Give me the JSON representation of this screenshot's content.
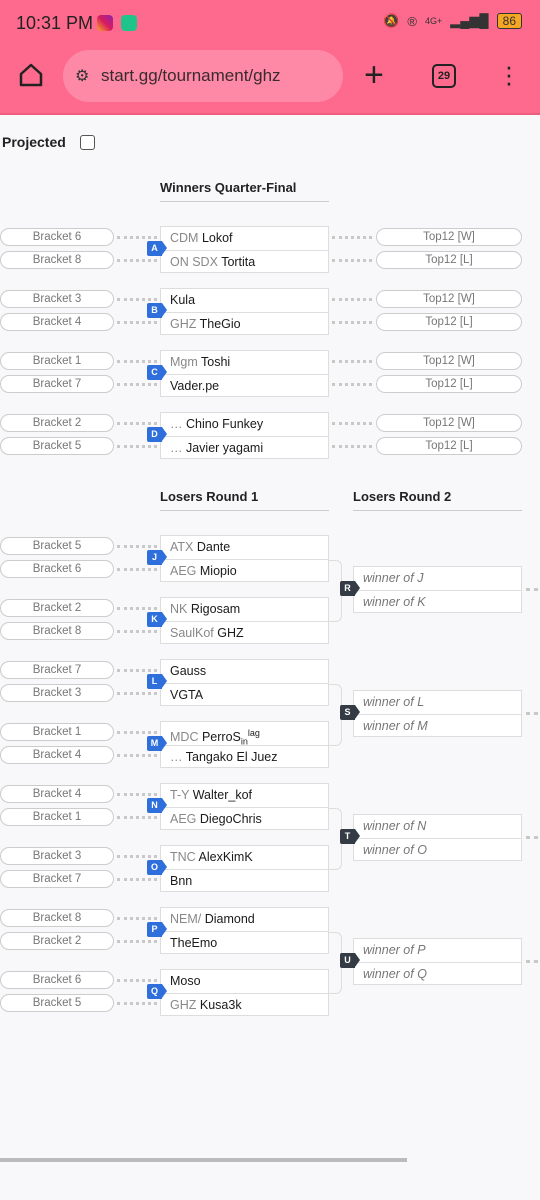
{
  "status_bar": {
    "time": "10:31 PM",
    "network": "4G+",
    "battery": "86",
    "colors": {
      "header": "#fd6a8e"
    }
  },
  "browser": {
    "url": "start.gg/tournament/ghz",
    "tab_count": "29"
  },
  "projected_label": "Projected",
  "projected_checked": false,
  "colors": {
    "winners_badge": "#2f6fdc",
    "losers_r2_badge": "#353b45"
  },
  "winners": {
    "title": "Winners Quarter-Final",
    "matches": [
      {
        "id": "A",
        "left": [
          "Bracket 6",
          "Bracket 8"
        ],
        "right": [
          "Top12 [W]",
          "Top12 [L]"
        ],
        "players": [
          {
            "prefix": "CDM",
            "name": "Lokof"
          },
          {
            "prefix": "ON SDX",
            "name": "Tortita"
          }
        ]
      },
      {
        "id": "B",
        "left": [
          "Bracket 3",
          "Bracket 4"
        ],
        "right": [
          "Top12 [W]",
          "Top12 [L]"
        ],
        "players": [
          {
            "prefix": "",
            "name": "Kula"
          },
          {
            "prefix": "GHZ",
            "name": "TheGio"
          }
        ]
      },
      {
        "id": "C",
        "left": [
          "Bracket 1",
          "Bracket 7"
        ],
        "right": [
          "Top12 [W]",
          "Top12 [L]"
        ],
        "players": [
          {
            "prefix": "Mgm",
            "name": "Toshi"
          },
          {
            "prefix": "",
            "name": "Vader.pe"
          }
        ]
      },
      {
        "id": "D",
        "left": [
          "Bracket 2",
          "Bracket 5"
        ],
        "right": [
          "Top12 [W]",
          "Top12 [L]"
        ],
        "players": [
          {
            "prefix": "…",
            "name": "Chino Funkey"
          },
          {
            "prefix": "…",
            "name": "Javier yagami"
          }
        ]
      }
    ]
  },
  "losers1": {
    "title": "Losers Round 1",
    "matches": [
      {
        "id": "J",
        "left": [
          "Bracket 5",
          "Bracket 6"
        ],
        "players": [
          {
            "prefix": "ATX",
            "name": "Dante"
          },
          {
            "prefix": "AEG",
            "name": "Miopio"
          }
        ]
      },
      {
        "id": "K",
        "left": [
          "Bracket 2",
          "Bracket 8"
        ],
        "players": [
          {
            "prefix": "NK",
            "name": "Rigosam"
          },
          {
            "prefix": "SaulKof",
            "name": "GHZ"
          }
        ]
      },
      {
        "id": "L",
        "left": [
          "Bracket 7",
          "Bracket 3"
        ],
        "players": [
          {
            "prefix": "",
            "name": "Gauss"
          },
          {
            "prefix": "",
            "name": "VGTA"
          }
        ]
      },
      {
        "id": "M",
        "left": [
          "Bracket 1",
          "Bracket 4"
        ],
        "players": [
          {
            "prefix": "MDC",
            "name": "PerroS",
            "sub": "in",
            "sup": "lag"
          },
          {
            "prefix": "…",
            "name": "Tangako El Juez"
          }
        ]
      },
      {
        "id": "N",
        "left": [
          "Bracket 4",
          "Bracket 1"
        ],
        "players": [
          {
            "prefix": "T-Y",
            "name": "Walter_kof"
          },
          {
            "prefix": "AEG",
            "name": "DiegoChris"
          }
        ]
      },
      {
        "id": "O",
        "left": [
          "Bracket 3",
          "Bracket 7"
        ],
        "players": [
          {
            "prefix": "TNC",
            "name": "AlexKimK"
          },
          {
            "prefix": "",
            "name": "Bnn"
          }
        ]
      },
      {
        "id": "P",
        "left": [
          "Bracket 8",
          "Bracket 2"
        ],
        "players": [
          {
            "prefix": "NEM/",
            "name": "Diamond"
          },
          {
            "prefix": "",
            "name": "TheEmo"
          }
        ]
      },
      {
        "id": "Q",
        "left": [
          "Bracket 6",
          "Bracket 5"
        ],
        "players": [
          {
            "prefix": "",
            "name": "Moso"
          },
          {
            "prefix": "GHZ",
            "name": "Kusa3k"
          }
        ]
      }
    ]
  },
  "losers2": {
    "title": "Losers Round 2",
    "matches": [
      {
        "id": "R",
        "players": [
          "winner of J",
          "winner of K"
        ]
      },
      {
        "id": "S",
        "players": [
          "winner of L",
          "winner of M"
        ]
      },
      {
        "id": "T",
        "players": [
          "winner of N",
          "winner of O"
        ]
      },
      {
        "id": "U",
        "players": [
          "winner of P",
          "winner of Q"
        ]
      }
    ]
  }
}
